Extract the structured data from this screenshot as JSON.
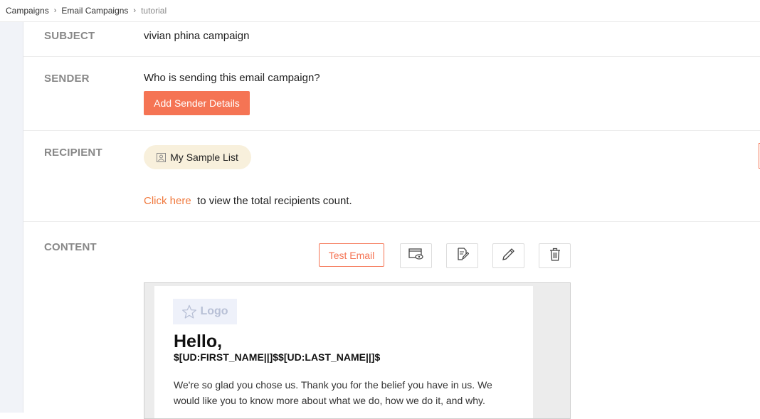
{
  "breadcrumb": {
    "items": [
      "Campaigns",
      "Email Campaigns"
    ],
    "current": "tutorial",
    "separator": "›"
  },
  "subject": {
    "label": "SUBJECT",
    "value": "vivian phina campaign"
  },
  "sender": {
    "label": "SENDER",
    "prompt": "Who is sending this email campaign?",
    "button": "Add Sender Details"
  },
  "recipient": {
    "label": "RECIPIENT",
    "list_name": "My Sample List",
    "link_text": "Click here",
    "link_suffix": "to view the total recipients count."
  },
  "content": {
    "label": "CONTENT",
    "test_email": "Test Email",
    "icons": [
      "preview-icon",
      "edit-text-icon",
      "pencil-icon",
      "trash-icon"
    ]
  },
  "preview": {
    "logo": "Logo",
    "greeting": "Hello,",
    "merge_tags": "$[UD:FIRST_NAME||]$$[UD:LAST_NAME||]$",
    "body": "We're so glad you chose us. Thank you for the belief you have in us. We would like you to know more about what we do, how we do it, and why."
  },
  "colors": {
    "accent": "#f57454",
    "link": "#f07a3f",
    "chip_bg": "#f8f0dc",
    "label": "#888888"
  }
}
